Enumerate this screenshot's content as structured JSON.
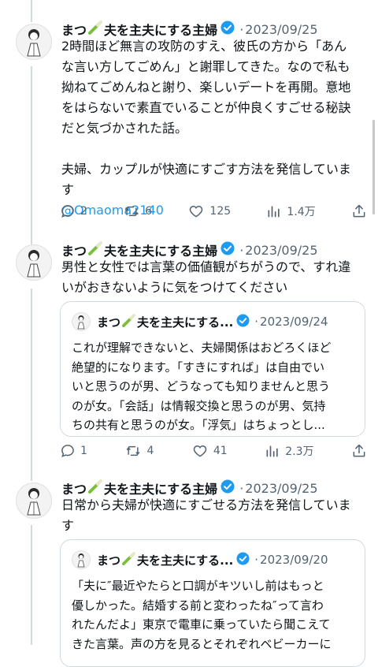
{
  "tweets": [
    {
      "name": "まつ",
      "suffix": "夫を主夫にする主婦",
      "date": "2023/09/25",
      "body": [
        "2時間ほど無言の攻防のすえ、彼氏の方から「あん",
        "な言い方してごめん」と謝罪してきた。なので私も",
        "拗ねてごめんねと謝り、楽しいデートを再開。意地",
        "をはらないで素直でいることが仲良くすごせる秘訣",
        "だと気づかされた話。",
        "",
        "夫婦、カップルが快適にすごす方法を発信していま",
        "す"
      ],
      "link": "@Omaoma2140",
      "replies": "2",
      "retweets": "6",
      "likes": "125",
      "views": "1.4万"
    },
    {
      "name": "まつ",
      "suffix": "夫を主夫にする主婦",
      "date": "2023/09/25",
      "body": [
        "男性と女性では言葉の価値観がちがうので、すれ違",
        "いがおきないように気をつけてください"
      ],
      "quote": {
        "name": "まつ",
        "suffix": "夫を主夫にする...",
        "date": "2023/09/24",
        "body": [
          "これが理解できないと、夫婦関係はおどろくほど",
          "絶望的になります。「すきにすれば」は自由でい",
          "いと思うのが男、どうなっても知りませんと思う",
          "のが女。「会話」は情報交換と思うのが男、気持",
          "ちの共有と思うのが女。「浮気」はちょっとし..."
        ]
      },
      "replies": "1",
      "retweets": "4",
      "likes": "41",
      "views": "2.3万"
    },
    {
      "name": "まつ",
      "suffix": "夫を主夫にする主婦",
      "date": "2023/09/25",
      "body": [
        "日常から夫婦が快適にすごせる方法を発信していま",
        "す"
      ],
      "quote": {
        "name": "まつ",
        "suffix": "夫を主夫にする...",
        "date": "2023/09/20",
        "body": [
          "「夫に″最近やたらと口調がキツいし前はもっと",
          "優しかった。結婚する前と変わったね″って言わ",
          "れたんだよ」東京で電車に乗っていたら聞こえて",
          "きた言葉。声の方を見るとそれぞれベビーカーに"
        ]
      }
    }
  ],
  "icons": {
    "verified": "verified-badge-icon",
    "leaf": "green-onion-icon",
    "reply": "reply-icon",
    "retweet": "retweet-icon",
    "like": "heart-icon",
    "views": "views-icon",
    "share": "share-icon"
  },
  "colors": {
    "verified": "#1d9bf0",
    "link": "#1d9bf0",
    "muted": "#536471"
  }
}
